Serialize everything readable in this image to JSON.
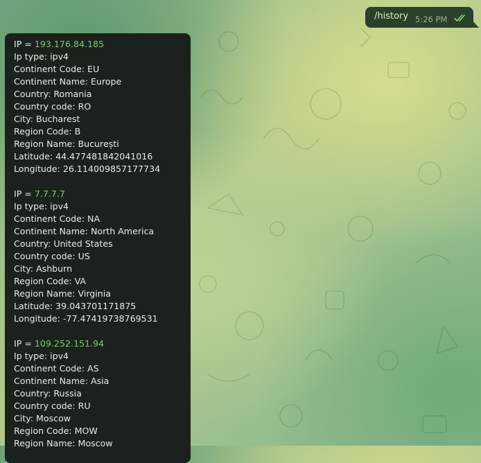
{
  "outgoing": {
    "text": "/history",
    "time": "5:26 PM",
    "status_icon": "double-check-icon"
  },
  "incoming": {
    "ip_prefix": "IP = ",
    "records": [
      {
        "ip": "193.176.84.185",
        "lines": [
          "Ip type:  ipv4",
          "Continent Code: EU",
          "Continent Name: Europe",
          "Country: Romania",
          "Country code: RO",
          "City: Bucharest",
          "Region Code: B",
          "Region Name:  București",
          "Latitude:  44.477481842041016",
          "Longitude: 26.114009857177734"
        ]
      },
      {
        "ip": "7.7.7.7",
        "lines": [
          "Ip type:  ipv4",
          "Continent Code: NA",
          "Continent Name: North America",
          "Country: United States",
          "Country code: US",
          "City: Ashburn",
          "Region Code: VA",
          "Region Name:  Virginia",
          "Latitude:  39.043701171875",
          "Longitude: -77.47419738769531"
        ]
      },
      {
        "ip": "109.252.151.94",
        "lines": [
          "Ip type:  ipv4",
          "Continent Code: AS",
          "Continent Name: Asia",
          "Country: Russia",
          "Country code: RU",
          "City: Moscow",
          "Region Code: MOW",
          "Region Name:  Moscow"
        ]
      }
    ]
  },
  "colors": {
    "outgoing_bubble": "#2b3f2d",
    "incoming_bubble": "#1b211d",
    "link": "#7ec86e",
    "check": "#8fd47a"
  }
}
